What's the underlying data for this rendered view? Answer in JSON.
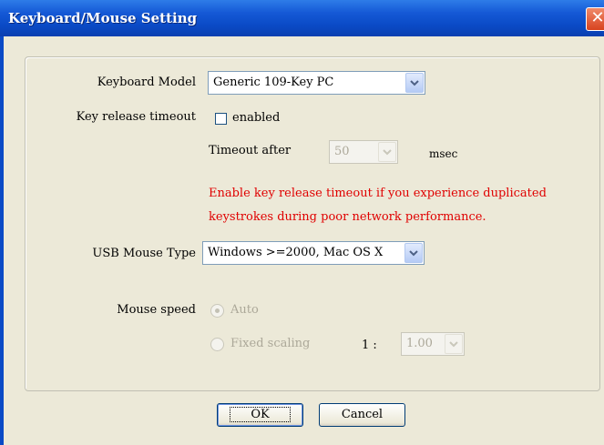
{
  "window": {
    "title": "Keyboard/Mouse Setting",
    "close_glyph": "✕"
  },
  "keyboard_model": {
    "label": "Keyboard Model",
    "value": "Generic 109-Key PC"
  },
  "key_release": {
    "label": "Key release timeout",
    "checkbox_label": "enabled",
    "checked": false,
    "timeout_label": "Timeout after",
    "timeout_value": "50",
    "unit": "msec",
    "warning_line1": "Enable key release timeout if you experience duplicated",
    "warning_line2": "keystrokes during poor network performance."
  },
  "usb_mouse": {
    "label": "USB Mouse Type",
    "value": "Windows >=2000, Mac OS X"
  },
  "mouse_speed": {
    "label": "Mouse speed",
    "auto_label": "Auto",
    "fixed_label": "Fixed scaling",
    "ratio_label": "1 :",
    "ratio_value": "1.00"
  },
  "buttons": {
    "ok": "OK",
    "cancel": "Cancel"
  },
  "colors": {
    "title_bar": "#0a4ac6",
    "warning": "#e00000",
    "background": "#ece9d8"
  }
}
